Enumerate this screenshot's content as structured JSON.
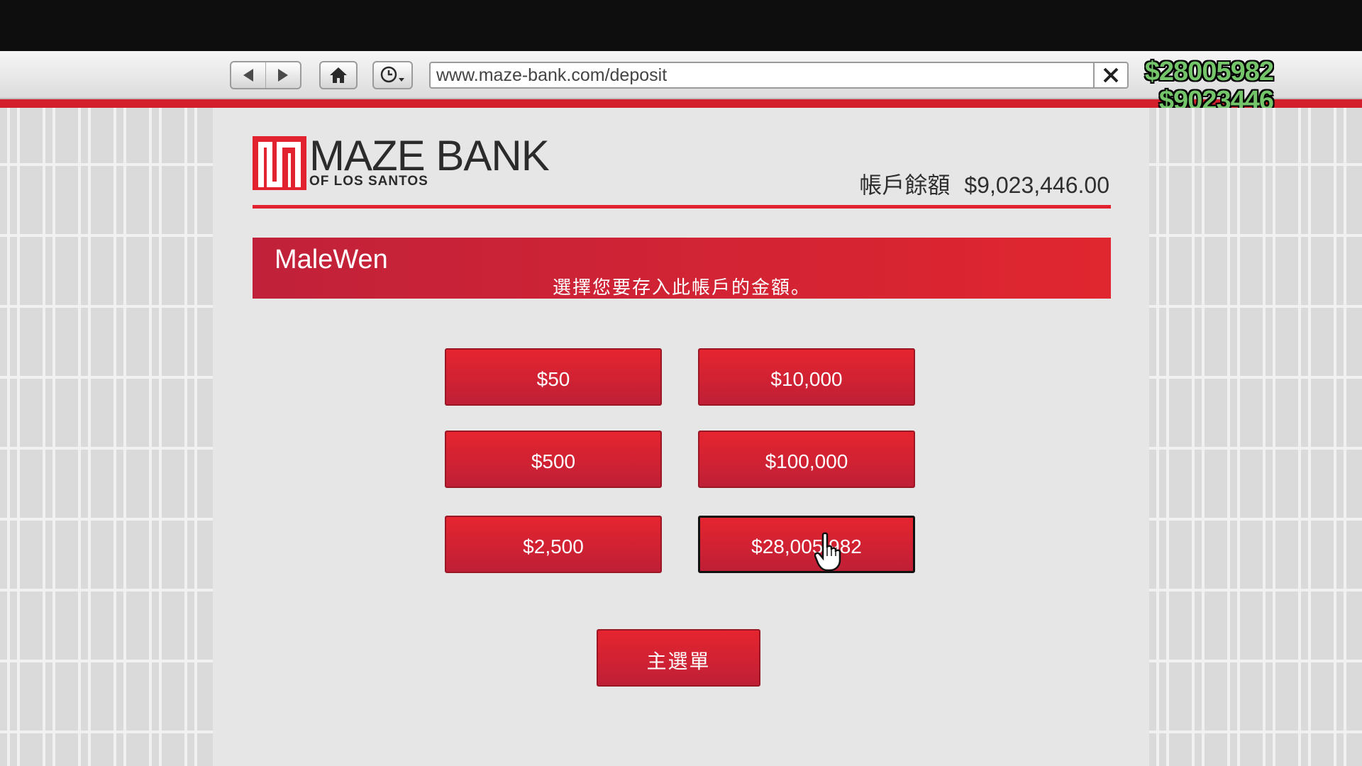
{
  "browser": {
    "url": "www.maze-bank.com/deposit"
  },
  "hud": {
    "cash": "$28005982",
    "bank": "$9023446"
  },
  "header": {
    "logo_name": "MAZE BANK",
    "logo_sub": "OF LOS SANTOS",
    "balance_label": "帳戶餘額",
    "balance_value": "$9,023,446.00"
  },
  "banner": {
    "username": "MaleWen",
    "message": "選擇您要存入此帳戶的金額。"
  },
  "amounts": {
    "a50": "$50",
    "a500": "$500",
    "a2500": "$2,500",
    "a10000": "$10,000",
    "a100000": "$100,000",
    "a_all": "$28,005,982"
  },
  "menu": {
    "main_menu": "主選單"
  },
  "colors": {
    "brand_red": "#e2232f",
    "hud_green": "#74c46a",
    "page_bg": "#e6e6e6"
  }
}
